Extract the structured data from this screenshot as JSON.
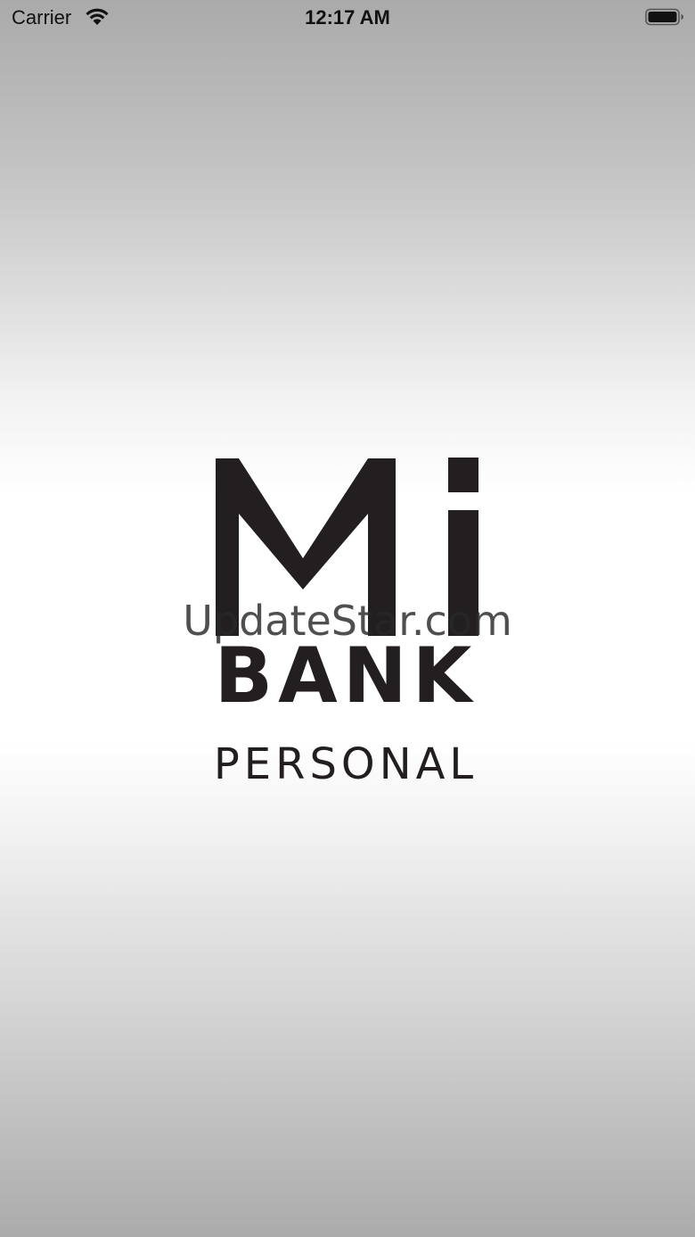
{
  "status_bar": {
    "carrier": "Carrier",
    "time": "12:17 AM",
    "wifi_icon": "wifi-icon",
    "battery_icon": "battery-icon"
  },
  "logo": {
    "mark": "Mi",
    "line2": "BANK",
    "line3": "PERSONAL",
    "color": "#231f20"
  },
  "watermark": {
    "text": "UpdateStar.com"
  }
}
